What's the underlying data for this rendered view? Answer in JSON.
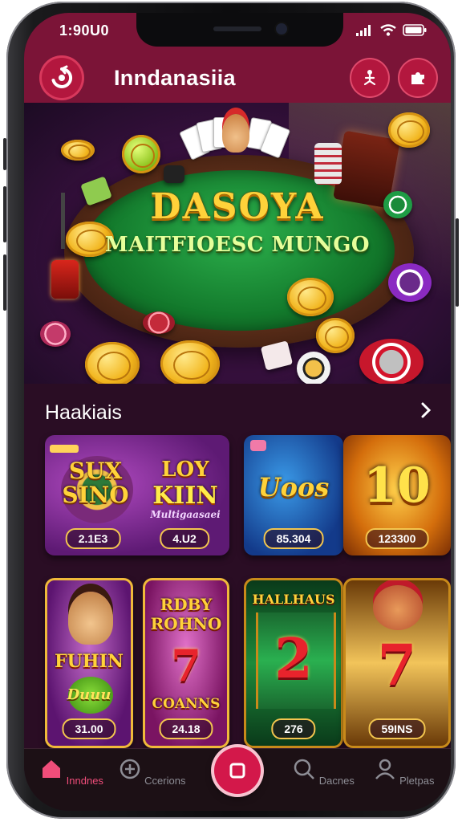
{
  "status_bar": {
    "time": "1:90U0"
  },
  "app_bar": {
    "title": "Inndanasiia",
    "logo_icon": "refresh-logo-icon",
    "right_icons": [
      "user-figure-icon",
      "puzzle-icon"
    ]
  },
  "hero": {
    "title": "DASOYA",
    "subtitle": "MAITFIOESC MUNGO"
  },
  "section": {
    "title": "Haakiais",
    "arrow_icon": "chevron-right-icon"
  },
  "games_row1": [
    {
      "name_line1": "SUX",
      "name_line2": "SINO",
      "value": "2.1E3",
      "theme": "#6b1a6e"
    },
    {
      "name_line1": "LOY",
      "name_line2": "KIIN",
      "tagline": "Multigaasaei",
      "value": "4.U2",
      "theme": "#8a2d8b"
    },
    {
      "name_line1": "Uoos",
      "value": "85.304",
      "theme": "#1a4a9a"
    },
    {
      "name_line1": "10",
      "value": "123300",
      "theme": "#d46e0c"
    }
  ],
  "games_row2": [
    {
      "name_line1": "FUHIN",
      "name_line2": "Duuu",
      "value": "31.00",
      "theme": "#6c1778"
    },
    {
      "name_line1": "RDBY",
      "name_line2": "ROHNO",
      "name_line3": "COANNS",
      "value": "24.18",
      "theme": "#8c1f6d"
    },
    {
      "name_line1": "HALLHAUS",
      "reel_symbol": "2",
      "value": "276",
      "theme": "#0f5a2a"
    },
    {
      "reel_symbol": "7",
      "value": "59INS",
      "theme": "#c77d14"
    }
  ],
  "bottom_nav": [
    {
      "label": "Inndnes",
      "icon": "home-icon",
      "active": true
    },
    {
      "label": "Ccerions",
      "icon": "gamepad-icon",
      "active": false
    },
    {
      "label": "",
      "icon": "center-square-icon",
      "active": false
    },
    {
      "label": "Dacnes",
      "icon": "search-icon",
      "active": false
    },
    {
      "label": "Pletpas",
      "icon": "profile-icon",
      "active": false
    }
  ],
  "colors": {
    "header": "#7b1437",
    "accent": "#f04d7a",
    "background": "#2a0d24"
  }
}
